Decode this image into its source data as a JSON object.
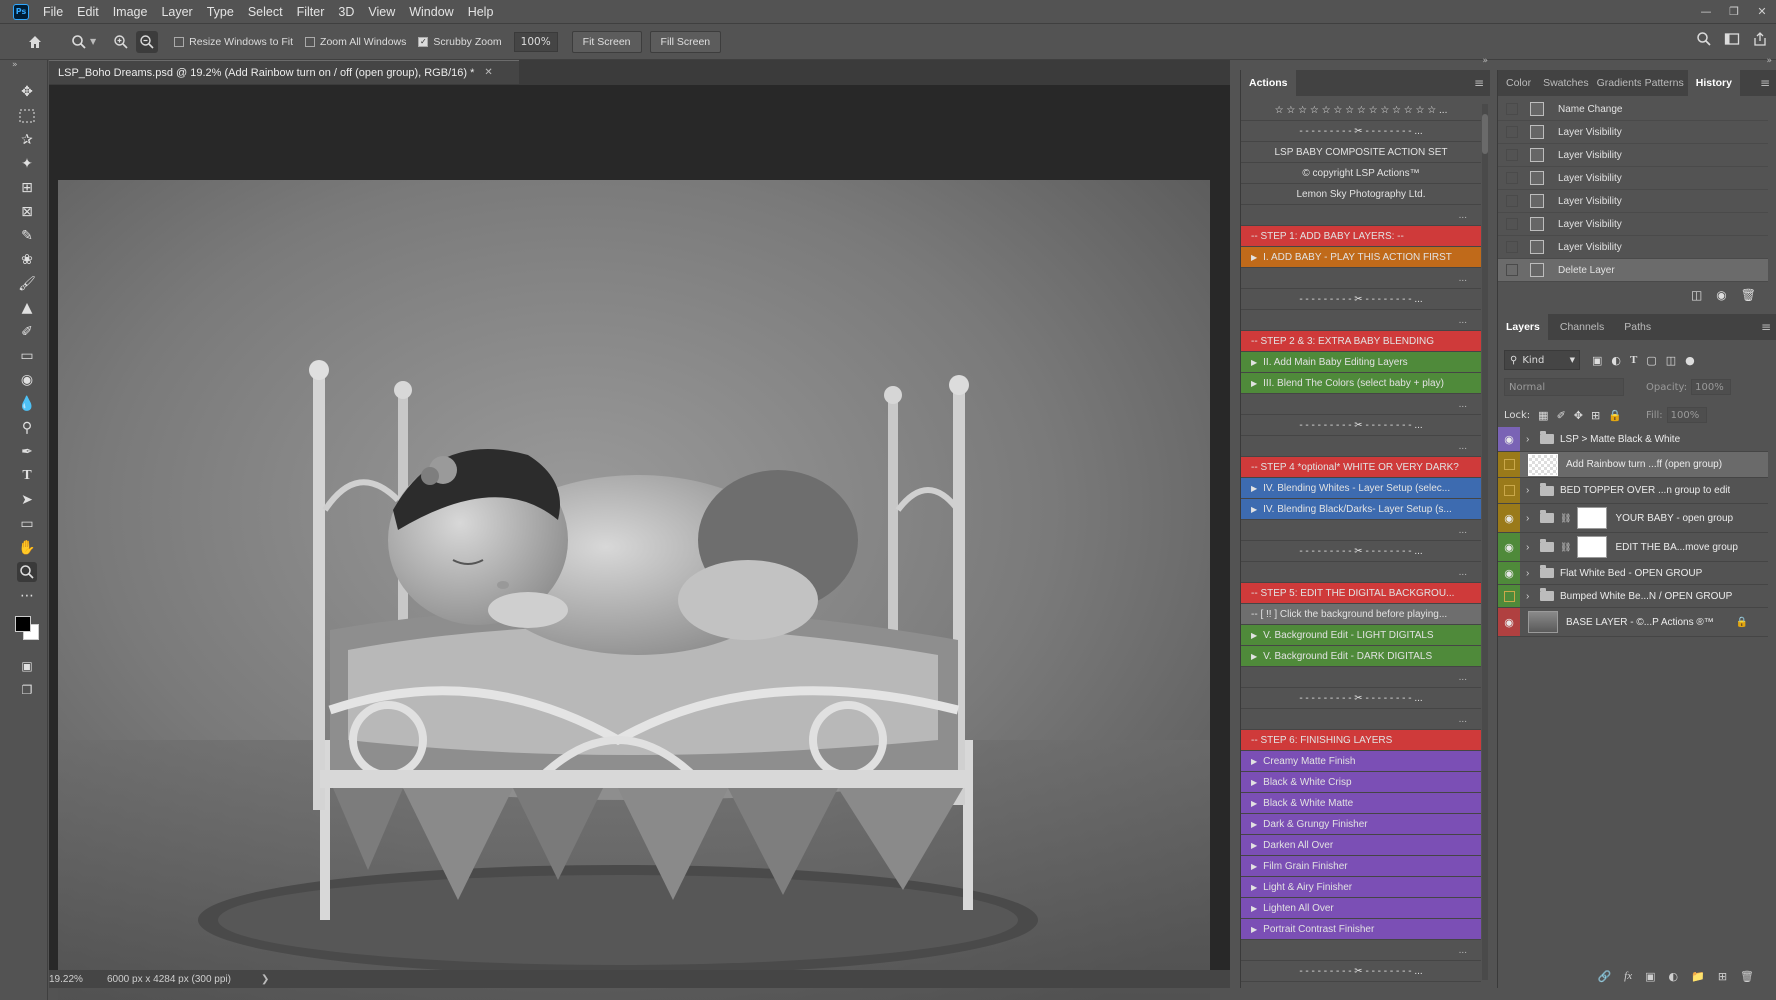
{
  "menubar": {
    "logo": "Ps",
    "items": [
      "File",
      "Edit",
      "Image",
      "Layer",
      "Type",
      "Select",
      "Filter",
      "3D",
      "View",
      "Window",
      "Help"
    ]
  },
  "options": {
    "resize_windows": "Resize Windows to Fit",
    "zoom_all": "Zoom All Windows",
    "scrubby_zoom": "Scrubby Zoom",
    "zoom_value": "100%",
    "fit_screen": "Fit Screen",
    "fill_screen": "Fill Screen"
  },
  "document": {
    "tab_title": "LSP_Boho Dreams.psd @ 19.2% (Add Rainbow turn on / off  (open group), RGB/16) *",
    "zoom": "19.22%",
    "dimensions": "6000 px x 4284 px (300 ppi)"
  },
  "actions_panel": {
    "tab": "Actions",
    "rows": [
      {
        "type": "center",
        "text": "☆ ☆ ☆ ☆ ☆ ☆ ☆ ☆ ☆ ☆ ☆ ☆ ☆ ☆ ..."
      },
      {
        "type": "center",
        "text": "- - - - - - - - - ✂ - - - - - - - - ..."
      },
      {
        "type": "center",
        "text": "LSP BABY COMPOSITE ACTION SET"
      },
      {
        "type": "center",
        "text": "© copyright LSP Actions™"
      },
      {
        "type": "center",
        "text": "Lemon Sky Photography Ltd."
      },
      {
        "type": "dots",
        "text": "..."
      },
      {
        "type": "item",
        "text": "-- STEP 1: ADD BABY LAYERS: --",
        "color": "#cf3a3a",
        "tri": false
      },
      {
        "type": "item",
        "text": "I. ADD BABY - PLAY THIS ACTION FIRST",
        "color": "#c06a1a",
        "tri": true
      },
      {
        "type": "dots",
        "text": "..."
      },
      {
        "type": "center",
        "text": "- - - - - - - - - ✂ - - - - - - - - ..."
      },
      {
        "type": "dots",
        "text": "..."
      },
      {
        "type": "item",
        "text": "-- STEP 2 & 3: EXTRA BABY BLENDING",
        "color": "#cf3a3a",
        "tri": false
      },
      {
        "type": "item",
        "text": "II.  Add Main Baby Editing Layers",
        "color": "#4f8a3a",
        "tri": true
      },
      {
        "type": "item",
        "text": "III. Blend The Colors (select baby + play)",
        "color": "#4f8a3a",
        "tri": true
      },
      {
        "type": "dots",
        "text": "..."
      },
      {
        "type": "center",
        "text": "- - - - - - - - - ✂ - - - - - - - - ..."
      },
      {
        "type": "dots",
        "text": "..."
      },
      {
        "type": "item",
        "text": "-- STEP 4 *optional* WHITE OR VERY DARK?",
        "color": "#cf3a3a",
        "tri": false
      },
      {
        "type": "item",
        "text": "IV. Blending Whites - Layer Setup (selec...",
        "color": "#3d6bb0",
        "tri": true
      },
      {
        "type": "item",
        "text": "IV. Blending Black/Darks- Layer Setup (s...",
        "color": "#3d6bb0",
        "tri": true
      },
      {
        "type": "dots",
        "text": "..."
      },
      {
        "type": "center",
        "text": "- - - - - - - - - ✂ - - - - - - - - ..."
      },
      {
        "type": "dots",
        "text": "..."
      },
      {
        "type": "item",
        "text": "-- STEP 5: EDIT THE DIGITAL BACKGROU...",
        "color": "#cf3a3a",
        "tri": false
      },
      {
        "type": "item",
        "text": "-- [ !! ] Click the background before playing...",
        "color": "#6e6e6e",
        "tri": false
      },
      {
        "type": "item",
        "text": "V. Background Edit - LIGHT DIGITALS",
        "color": "#4f8a3a",
        "tri": true
      },
      {
        "type": "item",
        "text": "V. Background Edit - DARK DIGITALS",
        "color": "#4f8a3a",
        "tri": true
      },
      {
        "type": "dots",
        "text": "..."
      },
      {
        "type": "center",
        "text": "- - - - - - - - - ✂ - - - - - - - - ..."
      },
      {
        "type": "dots",
        "text": "..."
      },
      {
        "type": "item",
        "text": "-- STEP 6: FINISHING LAYERS",
        "color": "#cf3a3a",
        "tri": false
      },
      {
        "type": "item",
        "text": "Creamy Matte Finish",
        "color": "#7b4fb5",
        "tri": true
      },
      {
        "type": "item",
        "text": "Black & White Crisp",
        "color": "#7b4fb5",
        "tri": true
      },
      {
        "type": "item",
        "text": "Black & White Matte",
        "color": "#7b4fb5",
        "tri": true
      },
      {
        "type": "item",
        "text": "Dark & Grungy Finisher",
        "color": "#7b4fb5",
        "tri": true
      },
      {
        "type": "item",
        "text": "Darken All Over",
        "color": "#7b4fb5",
        "tri": true
      },
      {
        "type": "item",
        "text": "Film Grain Finisher",
        "color": "#7b4fb5",
        "tri": true
      },
      {
        "type": "item",
        "text": "Light & Airy Finisher",
        "color": "#7b4fb5",
        "tri": true
      },
      {
        "type": "item",
        "text": "Lighten All Over",
        "color": "#7b4fb5",
        "tri": true
      },
      {
        "type": "item",
        "text": "Portrait Contrast Finisher",
        "color": "#7b4fb5",
        "tri": true
      },
      {
        "type": "dots",
        "text": "..."
      },
      {
        "type": "center",
        "text": "- - - - - - - - - ✂ - - - - - - - - ..."
      }
    ]
  },
  "history_panel": {
    "tabs": [
      "Color",
      "Swatches",
      "Gradients",
      "Patterns",
      "History"
    ],
    "items": [
      "Name Change",
      "Layer Visibility",
      "Layer Visibility",
      "Layer Visibility",
      "Layer Visibility",
      "Layer Visibility",
      "Layer Visibility",
      "Delete Layer"
    ]
  },
  "layers_panel": {
    "tabs": [
      "Layers",
      "Channels",
      "Paths"
    ],
    "kind": "Kind",
    "blend_mode": "Normal",
    "opacity_label": "Opacity:",
    "opacity_value": "100%",
    "lock_label": "Lock:",
    "fill_label": "Fill:",
    "fill_value": "100%",
    "layers": [
      {
        "name": "LSP > Matte Black & White",
        "color": "#7a63b5",
        "visible": true,
        "kind": "folder"
      },
      {
        "name": "Add Rainbow turn ...ff  (open group)",
        "color": "#9a7a1a",
        "visible": false,
        "kind": "thumb-check"
      },
      {
        "name": "BED TOPPER OVER ...n group to edit",
        "color": "#9a7a1a",
        "visible": false,
        "kind": "folder"
      },
      {
        "name": "YOUR BABY - open group",
        "color": "#9a7a1a",
        "visible": true,
        "kind": "folder-mask"
      },
      {
        "name": "EDIT THE BA...move group",
        "color": "#4f8a3a",
        "visible": true,
        "kind": "folder-mask"
      },
      {
        "name": "Flat White Bed - OPEN GROUP",
        "color": "#4f8a3a",
        "visible": true,
        "kind": "folder"
      },
      {
        "name": "Bumped White Be...N / OPEN GROUP",
        "color": "#4f8a3a",
        "visible": false,
        "kind": "folder"
      },
      {
        "name": "BASE LAYER - ©...P Actions ®™",
        "color": "#b04040",
        "visible": true,
        "kind": "photo"
      }
    ]
  }
}
